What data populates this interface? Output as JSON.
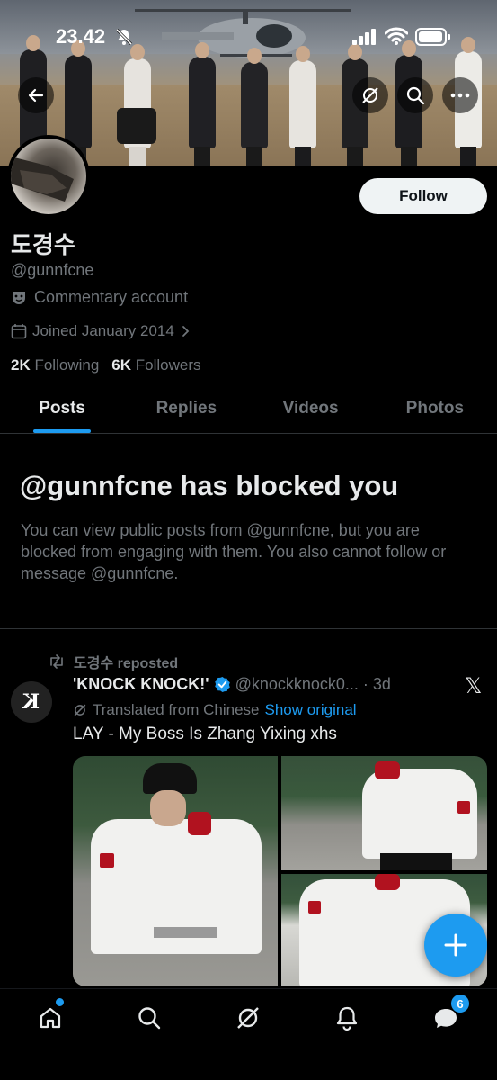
{
  "status_bar": {
    "time": "23.42"
  },
  "profile": {
    "display_name": "도경수",
    "handle": "@gunnfcne",
    "bio": "Commentary account",
    "joined": "Joined January 2014",
    "following_count": "2K",
    "following_label": "Following",
    "followers_count": "6K",
    "followers_label": "Followers",
    "follow_button": "Follow"
  },
  "tabs": [
    {
      "label": "Posts",
      "active": true
    },
    {
      "label": "Replies",
      "active": false
    },
    {
      "label": "Videos",
      "active": false
    },
    {
      "label": "Photos",
      "active": false
    }
  ],
  "blocked": {
    "title": "@gunnfcne has blocked you",
    "description": "You can view public posts from @gunnfcne, but you are blocked from engaging with them. You also cannot follow or message @gunnfcne."
  },
  "post": {
    "repost_label": "도경수 reposted",
    "author_name": "'KNOCK KNOCK!'",
    "author_handle": "@knockknock0...",
    "separator": "·",
    "date": "3d",
    "translated_label": "Translated from Chinese",
    "show_original": "Show original",
    "text": "LAY - My Boss Is Zhang Yixing xhs",
    "avatar_text": "K"
  },
  "bottom_nav": {
    "items": [
      "home-icon",
      "search-icon",
      "grok-icon",
      "notifications-icon",
      "messages-icon"
    ],
    "messages_badge": "6"
  },
  "colors": {
    "accent": "#1d9bf0",
    "background": "#000000",
    "text": "#e7e9ea",
    "muted": "#71767b"
  }
}
